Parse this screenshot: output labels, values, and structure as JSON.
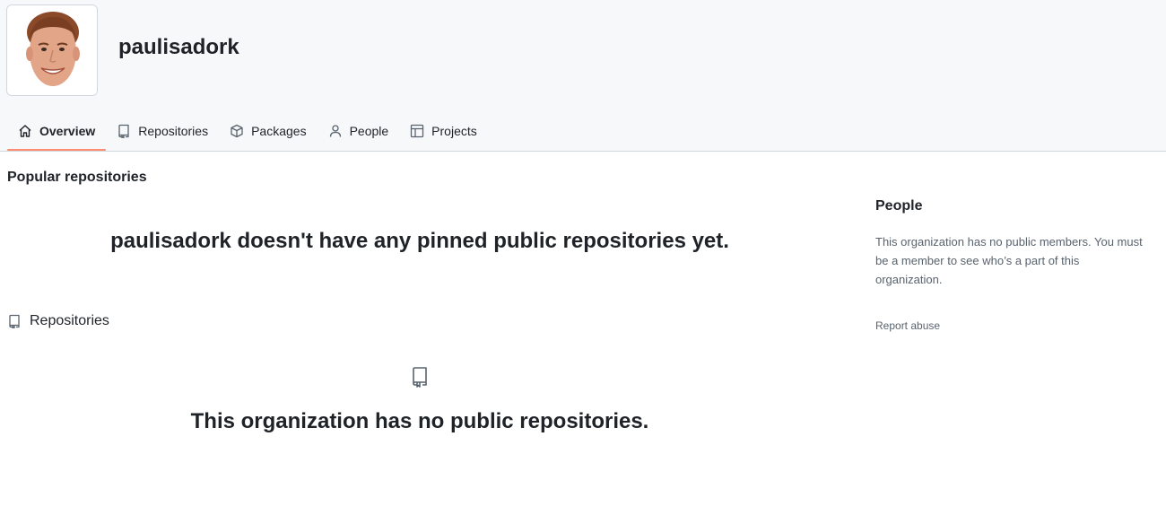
{
  "org": {
    "name": "paulisadork"
  },
  "nav": {
    "tabs": [
      {
        "label": "Overview",
        "icon": "home-icon",
        "active": true
      },
      {
        "label": "Repositories",
        "icon": "repo-icon",
        "active": false
      },
      {
        "label": "Packages",
        "icon": "package-icon",
        "active": false
      },
      {
        "label": "People",
        "icon": "person-icon",
        "active": false
      },
      {
        "label": "Projects",
        "icon": "table-icon",
        "active": false
      }
    ]
  },
  "popular": {
    "heading": "Popular repositories",
    "empty_message": "paulisadork doesn't have any pinned public repositories yet."
  },
  "repositories": {
    "heading": "Repositories",
    "empty_message": "This organization has no public repositories."
  },
  "sidebar": {
    "people_heading": "People",
    "people_description": "This organization has no public members. You must be a member to see who’s a part of this organization.",
    "report_abuse": "Report abuse"
  },
  "colors": {
    "header_bg": "#f6f8fa",
    "active_tab_underline": "#fd8c73",
    "muted_text": "#59636e",
    "border": "#d0d7de"
  }
}
